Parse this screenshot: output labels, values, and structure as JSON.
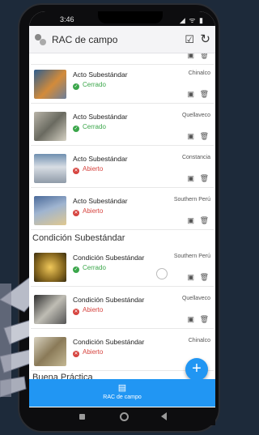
{
  "status": {
    "time": "3:46",
    "icons": "◢ ᯤ ▮"
  },
  "app": {
    "title": "RAC de campo"
  },
  "sections": {
    "condicion": "Condición Subestándar",
    "buena": "Buena Práctica"
  },
  "items": [
    {
      "title": "Acto Subestándar",
      "status": "Cerrado",
      "location": "Chinalco"
    },
    {
      "title": "Acto Subestándar",
      "status": "Cerrado",
      "location": "Quellaveco"
    },
    {
      "title": "Acto Subestándar",
      "status": "Abierto",
      "location": "Constancia"
    },
    {
      "title": "Acto Subestándar",
      "status": "Abierto",
      "location": "Southern Perú"
    },
    {
      "title": "Condición Subestándar",
      "status": "Cerrado",
      "location": "Southern Perú"
    },
    {
      "title": "Condición Subestándar",
      "status": "Abierto",
      "location": "Quellaveco"
    },
    {
      "title": "Condición Subestándar",
      "status": "Abierto",
      "location": "Chinalco"
    }
  ],
  "bottom_nav": {
    "label": "RAC de campo"
  },
  "colors": {
    "accent": "#2196f3",
    "closed": "#3aa64a",
    "open": "#d6443f"
  }
}
